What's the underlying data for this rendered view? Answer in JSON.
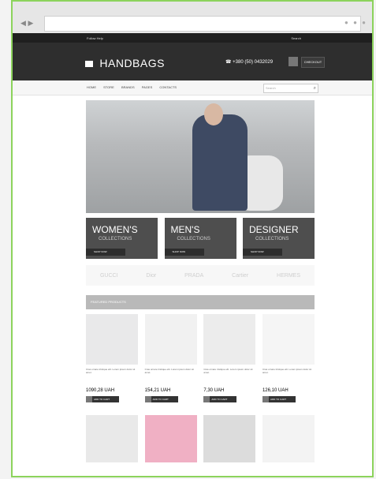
{
  "browser": {
    "back_icon": "back-arrow-icon",
    "forward_icon": "forward-arrow-icon"
  },
  "topbar": {
    "left": "Follow Help",
    "right": "Search"
  },
  "header": {
    "logo": "HANDBAGS",
    "phone": "+380 (50) 0432029",
    "cart_label": "CHECKOUT"
  },
  "menu": {
    "items": [
      "HOME",
      "STORE",
      "BRANDS",
      "PAGES",
      "CONTACTS"
    ],
    "search_placeholder": "Search"
  },
  "categories": [
    {
      "title": "WOMEN'S",
      "subtitle": "COLLECTIONS",
      "button": "SHOP NOW"
    },
    {
      "title": "MEN'S",
      "subtitle": "COLLECTIONS",
      "button": "SHOP NOW"
    },
    {
      "title": "DESIGNER",
      "subtitle": "COLLECTIONS",
      "button": "SHOP NOW"
    }
  ],
  "brands": [
    "GUCCI",
    "Dior",
    "PRADA",
    "Cartier",
    "HERMES"
  ],
  "featured": {
    "title": "FEATURED PRODUCTS"
  },
  "products": [
    {
      "desc": "Cras ornare tristique elit. Lorem ipsum dolor sit amet.",
      "price": "1090,28 UAH",
      "button": "ADD TO CART"
    },
    {
      "desc": "Cras ornare tristique elit. Lorem ipsum dolor sit amet.",
      "price": "154,21 UAH",
      "button": "ADD TO CART"
    },
    {
      "desc": "Cras ornare tristique elit. Lorem ipsum dolor sit amet.",
      "price": "7,30 UAH",
      "button": "ADD TO CART"
    },
    {
      "desc": "Cras ornare tristique elit. Lorem ipsum dolor sit amet.",
      "price": "126,10 UAH",
      "button": "ADD TO CART"
    }
  ]
}
